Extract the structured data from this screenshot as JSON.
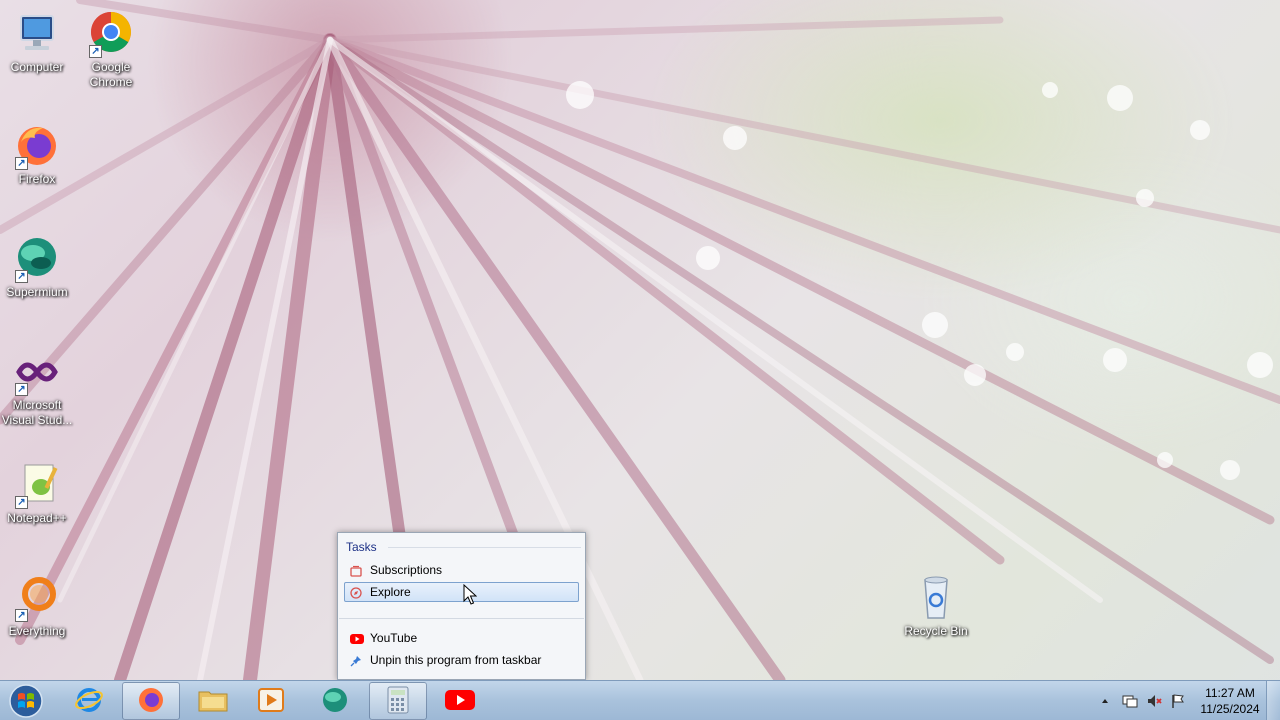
{
  "desktop": {
    "icons": [
      {
        "label": "Computer",
        "shortcut": false
      },
      {
        "label": "Google Chrome",
        "shortcut": true
      },
      {
        "label": "Firefox",
        "shortcut": true
      },
      {
        "label": "Supermium",
        "shortcut": true
      },
      {
        "label": "Microsoft Visual Stud...",
        "shortcut": true
      },
      {
        "label": "Notepad++",
        "shortcut": true
      },
      {
        "label": "Everything",
        "shortcut": true
      },
      {
        "label": "Recycle Bin",
        "shortcut": false
      }
    ]
  },
  "jumplist": {
    "heading": "Tasks",
    "tasks": [
      {
        "label": "Subscriptions",
        "icon": "subscriptions-icon"
      },
      {
        "label": "Explore",
        "icon": "explore-icon",
        "highlighted": true
      }
    ],
    "app_label": "YouTube",
    "unpin_label": "Unpin this program from taskbar"
  },
  "taskbar": {
    "buttons": [
      {
        "name": "internet-explorer",
        "icon": "internet-explorer-icon"
      },
      {
        "name": "firefox",
        "icon": "firefox-icon",
        "active": true
      },
      {
        "name": "file-explorer",
        "icon": "folder-icon"
      },
      {
        "name": "media-player",
        "icon": "media-player-icon"
      },
      {
        "name": "supermium",
        "icon": "supermium-icon"
      },
      {
        "name": "calculator",
        "icon": "calculator-icon",
        "active": true
      },
      {
        "name": "youtube",
        "icon": "youtube-icon"
      }
    ],
    "clock": {
      "time": "11:27 AM",
      "date": "11/25/2024"
    }
  },
  "colors": {
    "youtube_red": "#ff0000",
    "jumplist_heading": "#1e3287",
    "taskbar": "#a9c2dc"
  }
}
